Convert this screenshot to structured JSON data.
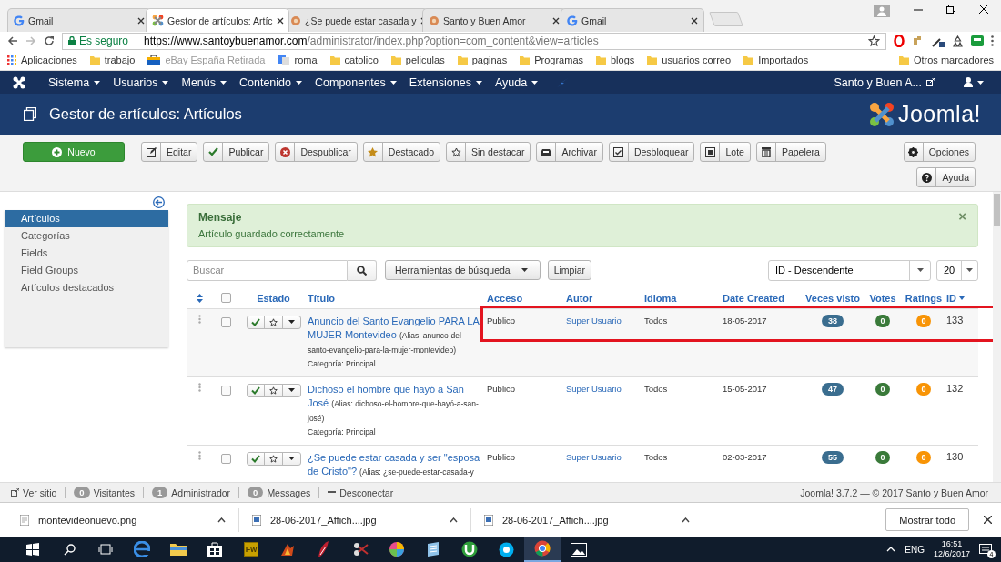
{
  "browser_tabs": [
    {
      "title": "Gmail",
      "kind": "google",
      "selected": false
    },
    {
      "title": "Gestor de artículos: Artíc",
      "kind": "joomla",
      "selected": true
    },
    {
      "title": "¿Se puede estar casada y",
      "kind": "site",
      "selected": false
    },
    {
      "title": "Santo y Buen Amor",
      "kind": "site",
      "selected": false
    },
    {
      "title": "Gmail",
      "kind": "google",
      "selected": false
    }
  ],
  "address": {
    "secure_label": "Es seguro",
    "url_host": "https://www.santoybuenamor.com",
    "url_path": "/administrator/index.php?option=com_content&view=articles"
  },
  "bookmarks": [
    {
      "label": "Aplicaciones",
      "kind": "apps"
    },
    {
      "label": "trabajo",
      "kind": "folder"
    },
    {
      "label": "eBay España Retirada",
      "kind": "page"
    },
    {
      "label": "roma",
      "kind": "translate"
    },
    {
      "label": "catolico",
      "kind": "folder"
    },
    {
      "label": "peliculas",
      "kind": "folder"
    },
    {
      "label": "paginas",
      "kind": "folder"
    },
    {
      "label": "Programas",
      "kind": "folder"
    },
    {
      "label": "blogs",
      "kind": "folder"
    },
    {
      "label": "usuarios correo",
      "kind": "folder"
    },
    {
      "label": "Importados",
      "kind": "folder"
    }
  ],
  "other_bookmarks": "Otros marcadores",
  "admin_menu": [
    "Sistema",
    "Usuarios",
    "Menús",
    "Contenido",
    "Componentes",
    "Extensiones",
    "Ayuda"
  ],
  "site_link": "Santo y Buen A...",
  "page_title": "Gestor de artículos: Artículos",
  "logo_text": "Joomla!",
  "toolbar": [
    {
      "label": "Nuevo",
      "kind": "new"
    },
    {
      "label": "Editar",
      "kind": "edit"
    },
    {
      "label": "Publicar",
      "kind": "publish"
    },
    {
      "label": "Despublicar",
      "kind": "unpublish"
    },
    {
      "label": "Destacado",
      "kind": "feature"
    },
    {
      "label": "Sin destacar",
      "kind": "unfeature"
    },
    {
      "label": "Archivar",
      "kind": "archive"
    },
    {
      "label": "Desbloquear",
      "kind": "checkin"
    },
    {
      "label": "Lote",
      "kind": "batch"
    },
    {
      "label": "Papelera",
      "kind": "trash"
    }
  ],
  "toolbar_right": [
    {
      "label": "Opciones",
      "kind": "options"
    },
    {
      "label": "Ayuda",
      "kind": "help"
    }
  ],
  "sidebar": [
    {
      "label": "Artículos",
      "selected": true
    },
    {
      "label": "Categorías",
      "selected": false
    },
    {
      "label": "Fields",
      "selected": false
    },
    {
      "label": "Field Groups",
      "selected": false
    },
    {
      "label": "Artículos destacados",
      "selected": false
    }
  ],
  "message": {
    "heading": "Mensaje",
    "text": "Artículo guardado correctamente",
    "close": "×"
  },
  "search": {
    "placeholder": "Buscar"
  },
  "search_tools": "Herramientas de búsqueda",
  "clear_button": "Limpiar",
  "sort": "ID - Descendente",
  "limit": "20",
  "select_all_checked": false,
  "columns": [
    "Estado",
    "Título",
    "Acceso",
    "Autor",
    "Idioma",
    "Date Created",
    "Veces visto",
    "Votes",
    "Ratings",
    "ID"
  ],
  "rows": [
    {
      "checked": false,
      "title": "Anuncio del Santo Evangelio PARA LA MUJER Montevideo",
      "alias": "(Alias: anunco-del-santo-evangelio-para-la-mujer-montevideo)",
      "category": "Categoría: Principal",
      "access": "Publico",
      "author": "Super Usuario",
      "language": "Todos",
      "date": "18-05-2017",
      "hits": "38",
      "votes": "0",
      "ratings": "0",
      "id": "133",
      "published": true,
      "featured": false,
      "marked": true
    },
    {
      "checked": false,
      "title": "Dichoso el hombre que hayó a San José",
      "alias": "(Alias: dichoso-el-hombre-que-hayó-a-san-josé)",
      "category": "Categoría: Principal",
      "access": "Publico",
      "author": "Super Usuario",
      "language": "Todos",
      "date": "15-05-2017",
      "hits": "47",
      "votes": "0",
      "ratings": "0",
      "id": "132",
      "published": true,
      "featured": false,
      "marked": false
    },
    {
      "checked": false,
      "title": "¿Se puede estar casada y ser \"esposa de Cristo\"?",
      "alias": "(Alias: ¿se-puede-estar-casada-y",
      "access": "Publico",
      "author": "Super Usuario",
      "language": "Todos",
      "date": "02-03-2017",
      "hits": "55",
      "votes": "0",
      "ratings": "0",
      "id": "130",
      "published": true,
      "featured": false,
      "marked": false
    }
  ],
  "status_bar": {
    "view_site": "Ver sitio",
    "counters": [
      {
        "count": "0",
        "label": "Visitantes"
      },
      {
        "count": "1",
        "label": "Administrador"
      },
      {
        "count": "0",
        "label": "Messages"
      }
    ],
    "logout": "Desconectar",
    "version": "Joomla! 3.7.2 — © 2017 Santo y Buen Amor"
  },
  "downloads": {
    "files": [
      "montevideonuevo.png",
      "28-06-2017_Affich....jpg",
      "28-06-2017_Affich....jpg"
    ],
    "show_all": "Mostrar todo"
  },
  "taskbar": {
    "fireworks_label": "Fw",
    "language": "ENG",
    "time": "16:51",
    "date": "12/6/2017",
    "notifications": "4"
  }
}
